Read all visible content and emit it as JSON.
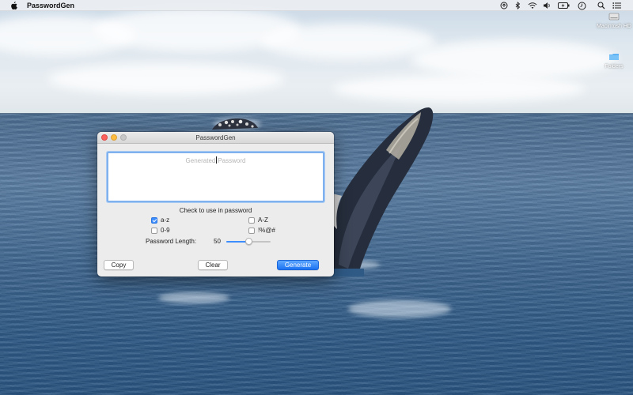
{
  "menubar": {
    "app_name": "PasswordGen",
    "status_icons": [
      "sync-icon",
      "bluetooth-icon",
      "wifi-icon",
      "volume-icon",
      "battery-icon",
      "clock-icon",
      "spotlight-search-icon",
      "notification-center-icon"
    ]
  },
  "desktop": {
    "icons": [
      {
        "label": "Macintosh HD",
        "icon": "hard-drive-icon"
      },
      {
        "label": "Folders",
        "icon": "folder-icon"
      }
    ]
  },
  "window": {
    "title": "PasswordGen",
    "password_field": {
      "placeholder_before_caret": "Generated",
      "placeholder_after_caret": "Password",
      "value": ""
    },
    "section_label": "Check to use in password",
    "options": [
      {
        "label": "a-z",
        "checked": true
      },
      {
        "label": "A-Z",
        "checked": false
      },
      {
        "label": "0-9",
        "checked": false
      },
      {
        "label": "!%@#",
        "checked": false
      }
    ],
    "length": {
      "label": "Password Length:",
      "value": "50",
      "slider_fraction": 0.5
    },
    "buttons": {
      "copy": "Copy",
      "clear": "Clear",
      "generate": "Generate"
    }
  },
  "colors": {
    "accent": "#3c8dff",
    "close": "#fc605c",
    "minimize": "#fdbc40",
    "maximize_disabled": "#c8c8c8"
  }
}
